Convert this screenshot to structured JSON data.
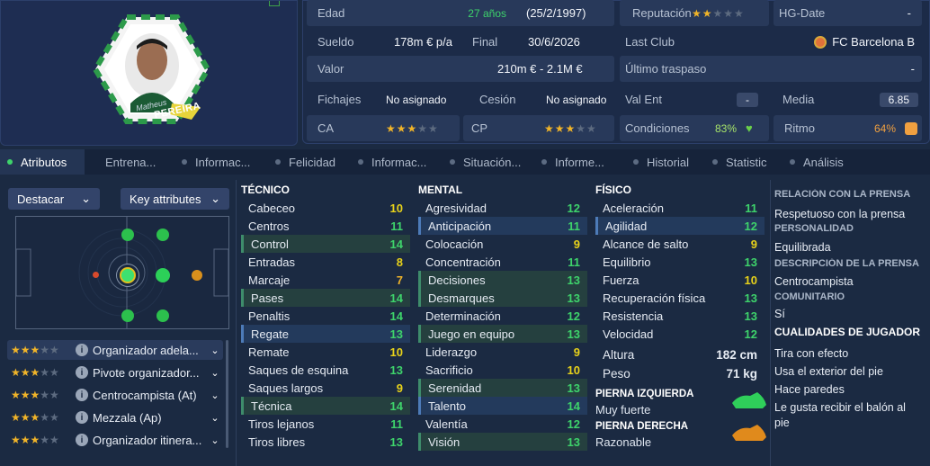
{
  "player": {
    "first_name": "Matheus",
    "last_name": "PEREIRA"
  },
  "info": {
    "edad_label": "Edad",
    "edad": "27 años",
    "dob": "(25/2/1997)",
    "reputacion_label": "Reputación",
    "reputacion_stars": 2,
    "hg_label": "HG-Date",
    "hg_value": "-",
    "sueldo_label": "Sueldo",
    "sueldo": "178m € p/a",
    "final_label": "Final",
    "final": "30/6/2026",
    "last_club_label": "Last Club",
    "last_club": "FC Barcelona B",
    "valor_label": "Valor",
    "valor": "210m € - 2.1M €",
    "ultimo_label": "Último traspaso",
    "ultimo": "-",
    "fichajes_label": "Fichajes",
    "fichajes": "No asignado",
    "cesion_label": "Cesión",
    "cesion": "No asignado",
    "valent_label": "Val Ent",
    "valent": "-",
    "media_label": "Media",
    "media": "6.85",
    "ca_label": "CA",
    "ca_stars": 3,
    "cp_label": "CP",
    "cp_stars": 3,
    "condiciones_label": "Condiciones",
    "condiciones": "83%",
    "ritmo_label": "Ritmo",
    "ritmo": "64%"
  },
  "tabs": [
    "Atributos",
    "Entrena...",
    "Informac...",
    "Felicidad",
    "Informac...",
    "Situación...",
    "Informe...",
    "Historial",
    "Statistic",
    "Análisis"
  ],
  "controls": {
    "destacar": "Destacar",
    "key_attributes": "Key attributes"
  },
  "roles": [
    {
      "stars": 3,
      "name": "Organizador adela..."
    },
    {
      "stars": 3,
      "name": "Pivote organizador..."
    },
    {
      "stars": 3,
      "name": "Centrocampista (At)"
    },
    {
      "stars": 3,
      "name": "Mezzala (Ap)"
    },
    {
      "stars": 3,
      "name": "Organizador itinera..."
    }
  ],
  "tecnico": {
    "title": "TÉCNICO",
    "items": [
      {
        "n": "Cabeceo",
        "v": "10"
      },
      {
        "n": "Centros",
        "v": "11"
      },
      {
        "n": "Control",
        "v": "14"
      },
      {
        "n": "Entradas",
        "v": "8"
      },
      {
        "n": "Marcaje",
        "v": "7"
      },
      {
        "n": "Pases",
        "v": "14"
      },
      {
        "n": "Penaltis",
        "v": "14"
      },
      {
        "n": "Regate",
        "v": "13"
      },
      {
        "n": "Remate",
        "v": "10"
      },
      {
        "n": "Saques de esquina",
        "v": "13"
      },
      {
        "n": "Saques largos",
        "v": "9"
      },
      {
        "n": "Técnica",
        "v": "14"
      },
      {
        "n": "Tiros lejanos",
        "v": "11"
      },
      {
        "n": "Tiros libres",
        "v": "13"
      }
    ]
  },
  "mental": {
    "title": "MENTAL",
    "items": [
      {
        "n": "Agresividad",
        "v": "12"
      },
      {
        "n": "Anticipación",
        "v": "11"
      },
      {
        "n": "Colocación",
        "v": "9"
      },
      {
        "n": "Concentración",
        "v": "11"
      },
      {
        "n": "Decisiones",
        "v": "13"
      },
      {
        "n": "Desmarques",
        "v": "13"
      },
      {
        "n": "Determinación",
        "v": "12"
      },
      {
        "n": "Juego en equipo",
        "v": "13"
      },
      {
        "n": "Liderazgo",
        "v": "9"
      },
      {
        "n": "Sacrificio",
        "v": "10"
      },
      {
        "n": "Serenidad",
        "v": "13"
      },
      {
        "n": "Talento",
        "v": "14"
      },
      {
        "n": "Valentía",
        "v": "12"
      },
      {
        "n": "Visión",
        "v": "13"
      }
    ]
  },
  "fisico": {
    "title": "FÍSICO",
    "items": [
      {
        "n": "Aceleración",
        "v": "11"
      },
      {
        "n": "Agilidad",
        "v": "12"
      },
      {
        "n": "Alcance de salto",
        "v": "9"
      },
      {
        "n": "Equilibrio",
        "v": "13"
      },
      {
        "n": "Fuerza",
        "v": "10"
      },
      {
        "n": "Recuperación física",
        "v": "13"
      },
      {
        "n": "Resistencia",
        "v": "13"
      },
      {
        "n": "Velocidad",
        "v": "12"
      }
    ]
  },
  "body": {
    "altura_label": "Altura",
    "altura": "182 cm",
    "peso_label": "Peso",
    "peso": "71 kg"
  },
  "feet": {
    "left_label": "PIERNA IZQUIERDA",
    "left": "Muy fuerte",
    "right_label": "PIERNA DERECHA",
    "right": "Razonable"
  },
  "side": {
    "relacion_h": "RELACIÓN CON LA PRENSA",
    "relacion": "Respetuoso con la prensa",
    "personalidad_h": "PERSONALIDAD",
    "personalidad": "Equilibrada",
    "descripcion_h": "DESCRIPCIÓN DE LA PRENSA",
    "descripcion": "Centrocampista",
    "comunitario_h": "COMUNITARIO",
    "comunitario": "Sí",
    "cualidades_h": "CUALIDADES DE JUGADOR",
    "cualidades": [
      "Tira con efecto",
      "Usa el exterior del pie",
      "Hace paredes",
      "Le gusta recibir el balón al",
      "pie"
    ]
  },
  "colors": {
    "green": "#3ed36b",
    "yellow": "#e8d21a",
    "orange": "#f0b429",
    "panel": "#28395a"
  }
}
